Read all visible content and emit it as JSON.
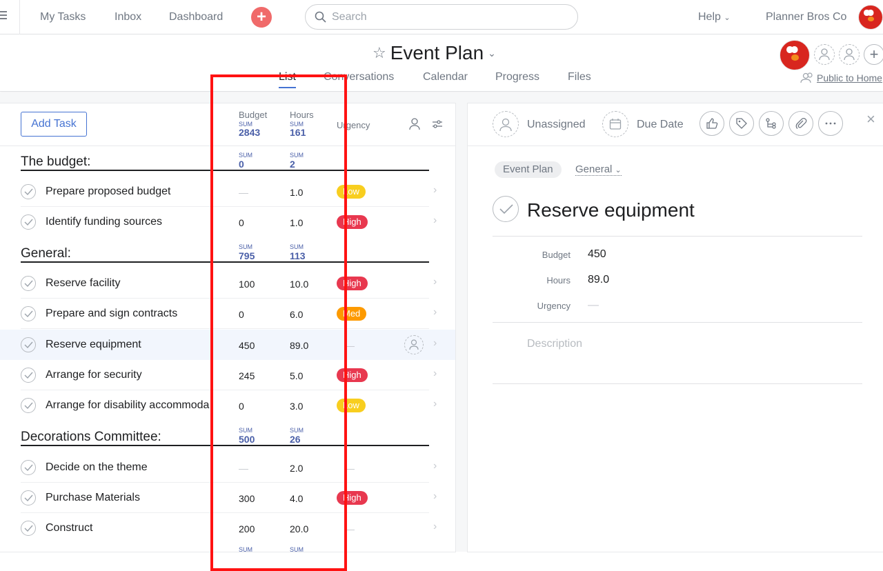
{
  "topbar": {
    "nav": [
      "My Tasks",
      "Inbox",
      "Dashboard"
    ],
    "search_placeholder": "Search",
    "help": "Help",
    "org": "Planner Bros Co"
  },
  "project": {
    "title": "Event Plan",
    "tabs": [
      "List",
      "Conversations",
      "Calendar",
      "Progress",
      "Files"
    ],
    "active_tab": "List",
    "visibility": "Public to Home"
  },
  "list": {
    "add_task": "Add Task",
    "columns": {
      "budget": {
        "label": "Budget",
        "sum_label": "SUM",
        "sum": "2843"
      },
      "hours": {
        "label": "Hours",
        "sum_label": "SUM",
        "sum": "161"
      },
      "urgency": {
        "label": "Urgency"
      }
    },
    "sections": [
      {
        "name": "The budget:",
        "sum_label": "SUM",
        "budget_sum": "0",
        "hours_sum": "2",
        "tasks": [
          {
            "name": "Prepare proposed budget",
            "budget": "—",
            "hours": "1.0",
            "urgency": "Low"
          },
          {
            "name": "Identify funding sources",
            "budget": "0",
            "hours": "1.0",
            "urgency": "High"
          }
        ]
      },
      {
        "name": "General:",
        "sum_label": "SUM",
        "budget_sum": "795",
        "hours_sum": "113",
        "tasks": [
          {
            "name": "Reserve facility",
            "budget": "100",
            "hours": "10.0",
            "urgency": "High"
          },
          {
            "name": "Prepare and sign contracts",
            "budget": "0",
            "hours": "6.0",
            "urgency": "Med"
          },
          {
            "name": "Reserve equipment",
            "budget": "450",
            "hours": "89.0",
            "urgency": "—"
          },
          {
            "name": "Arrange for security",
            "budget": "245",
            "hours": "5.0",
            "urgency": "High"
          },
          {
            "name": "Arrange for disability accommoda",
            "budget": "0",
            "hours": "3.0",
            "urgency": "Low"
          }
        ]
      },
      {
        "name": "Decorations Committee:",
        "sum_label": "SUM",
        "budget_sum": "500",
        "hours_sum": "26",
        "tasks": [
          {
            "name": "Decide on the theme",
            "budget": "—",
            "hours": "2.0",
            "urgency": "—"
          },
          {
            "name": "Purchase Materials",
            "budget": "300",
            "hours": "4.0",
            "urgency": "High"
          },
          {
            "name": "Construct",
            "budget": "200",
            "hours": "20.0",
            "urgency": "—"
          }
        ]
      }
    ],
    "trailing_sum_labels": [
      "SUM",
      "SUM"
    ]
  },
  "detail": {
    "assignee": "Unassigned",
    "due_date": "Due Date",
    "project_chip": "Event Plan",
    "section_chip": "General",
    "task_title": "Reserve equipment",
    "fields": [
      {
        "label": "Budget",
        "value": "450"
      },
      {
        "label": "Hours",
        "value": "89.0"
      },
      {
        "label": "Urgency",
        "value": "—"
      }
    ],
    "description_placeholder": "Description"
  },
  "colors": {
    "high": "#e8384f",
    "low": "#f8ce1f",
    "med": "#fd9a00",
    "accent": "#4573d2",
    "highlight_box": "#ff1212"
  }
}
